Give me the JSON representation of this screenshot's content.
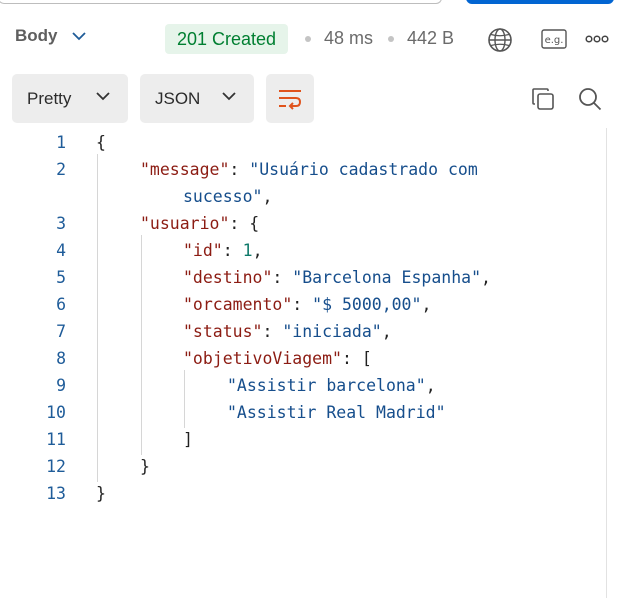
{
  "response": {
    "body_label": "Body",
    "status": "201 Created",
    "time": "48 ms",
    "size": "442 B",
    "colors": {
      "status_text": "#007f31",
      "status_bg": "#e6f4ea",
      "accent": "#e0531c",
      "send": "#0265d2"
    }
  },
  "toolbar": {
    "format_label": "Pretty",
    "type_label": "JSON",
    "icons": [
      "wrap-lines-icon",
      "copy-icon",
      "search-icon"
    ]
  },
  "header_icons": [
    "chevron-down-icon",
    "globe-icon",
    "example-icon",
    "more-icon"
  ],
  "code": {
    "line_numbers": [
      "1",
      "2",
      "3",
      "4",
      "5",
      "6",
      "7",
      "8",
      "9",
      "10",
      "11",
      "12",
      "13"
    ],
    "keys": {
      "message": "\"message\"",
      "usuario": "\"usuario\"",
      "id": "\"id\"",
      "destino": "\"destino\"",
      "orcamento": "\"orcamento\"",
      "status": "\"status\"",
      "objetivoViagem": "\"objetivoViagem\""
    },
    "values": {
      "message_part1": "\"Usuário cadastrado com",
      "message_part2": "sucesso\"",
      "id": "1",
      "destino": "\"Barcelona Espanha\"",
      "orcamento": "\"$ 5000,00\"",
      "status": "\"iniciada\"",
      "objetivo_1": "\"Assistir barcelona\"",
      "objetivo_2": "\"Assistir Real Madrid\""
    }
  }
}
